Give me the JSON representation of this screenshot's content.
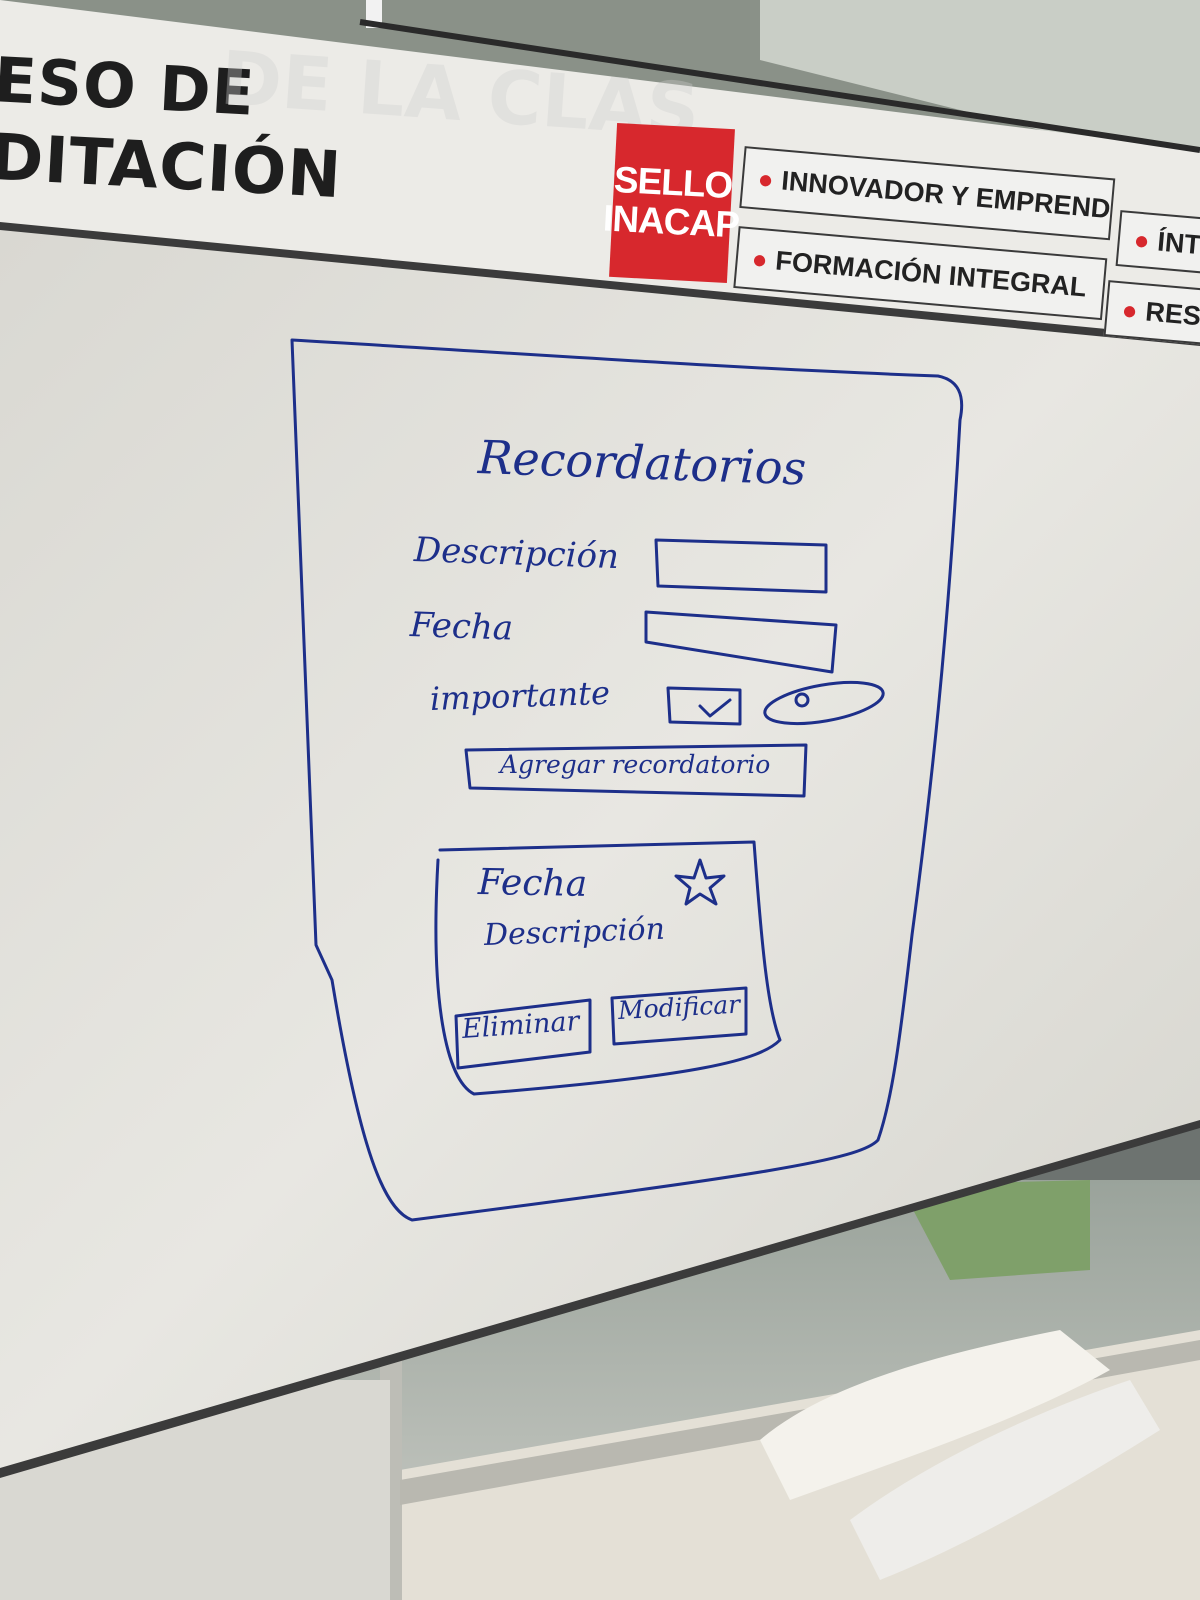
{
  "banner": {
    "line1": "ESO DE",
    "line2": "DITACIÓN",
    "ghost_text": "DE LA CLAS",
    "sello_line1": "SELLO",
    "sello_line2": "INACAP",
    "pills": [
      "INNOVADOR Y EMPRENDEDOR",
      "FORMACIÓN INTEGRAL",
      "ÍNTEG",
      "RESPO"
    ]
  },
  "sketch": {
    "title": "Recordatorios",
    "label_description": "Descripción",
    "label_date": "Fecha",
    "label_important": "importante",
    "add_button": "Agregar recordatorio",
    "card_date": "Fecha",
    "card_description": "Descripción",
    "delete_button": "Eliminar",
    "modify_button": "Modificar"
  },
  "colors": {
    "marker": "#1d2f8a",
    "sello_red": "#d7282d",
    "whiteboard": "#e6e5df"
  }
}
